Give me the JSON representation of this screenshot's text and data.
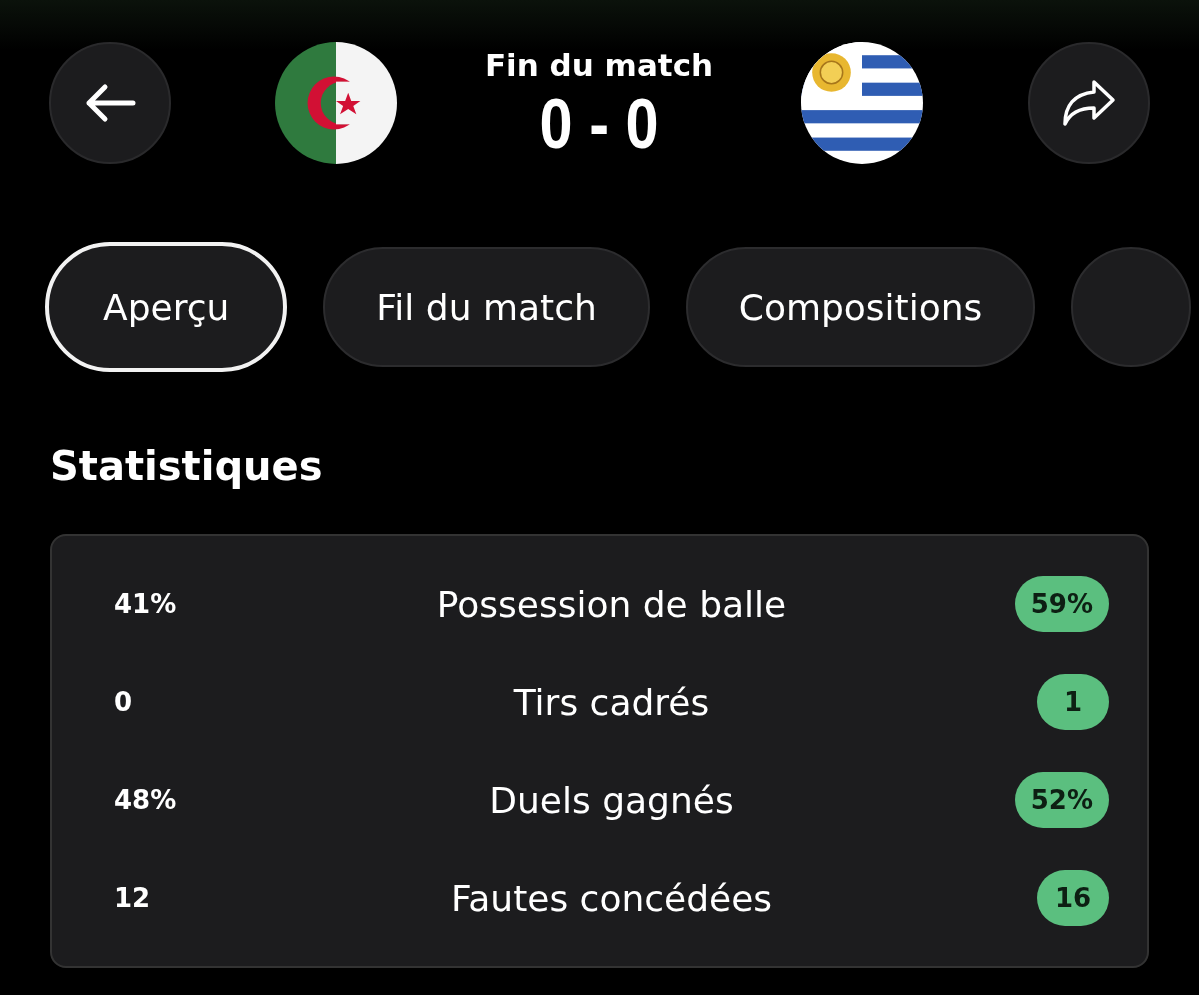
{
  "header": {
    "status": "Fin du match",
    "score": "0 - 0"
  },
  "tabs": [
    {
      "label": "Aperçu",
      "selected": true
    },
    {
      "label": "Fil du match",
      "selected": false
    },
    {
      "label": "Compositions",
      "selected": false
    },
    {
      "selected": false
    }
  ],
  "statistics": {
    "title": "Statistiques",
    "rows": [
      {
        "home": "41%",
        "label": "Possession de balle",
        "away": "59%",
        "home_highlighted": false,
        "away_highlighted": true
      },
      {
        "home": "0",
        "label": "Tirs cadrés",
        "away": "1",
        "home_highlighted": false,
        "away_highlighted": true
      },
      {
        "home": "48%",
        "label": "Duels gagnés",
        "away": "52%",
        "home_highlighted": false,
        "away_highlighted": true
      },
      {
        "home": "12",
        "label": "Fautes concédées",
        "away": "16",
        "home_highlighted": false,
        "away_highlighted": true
      }
    ]
  }
}
